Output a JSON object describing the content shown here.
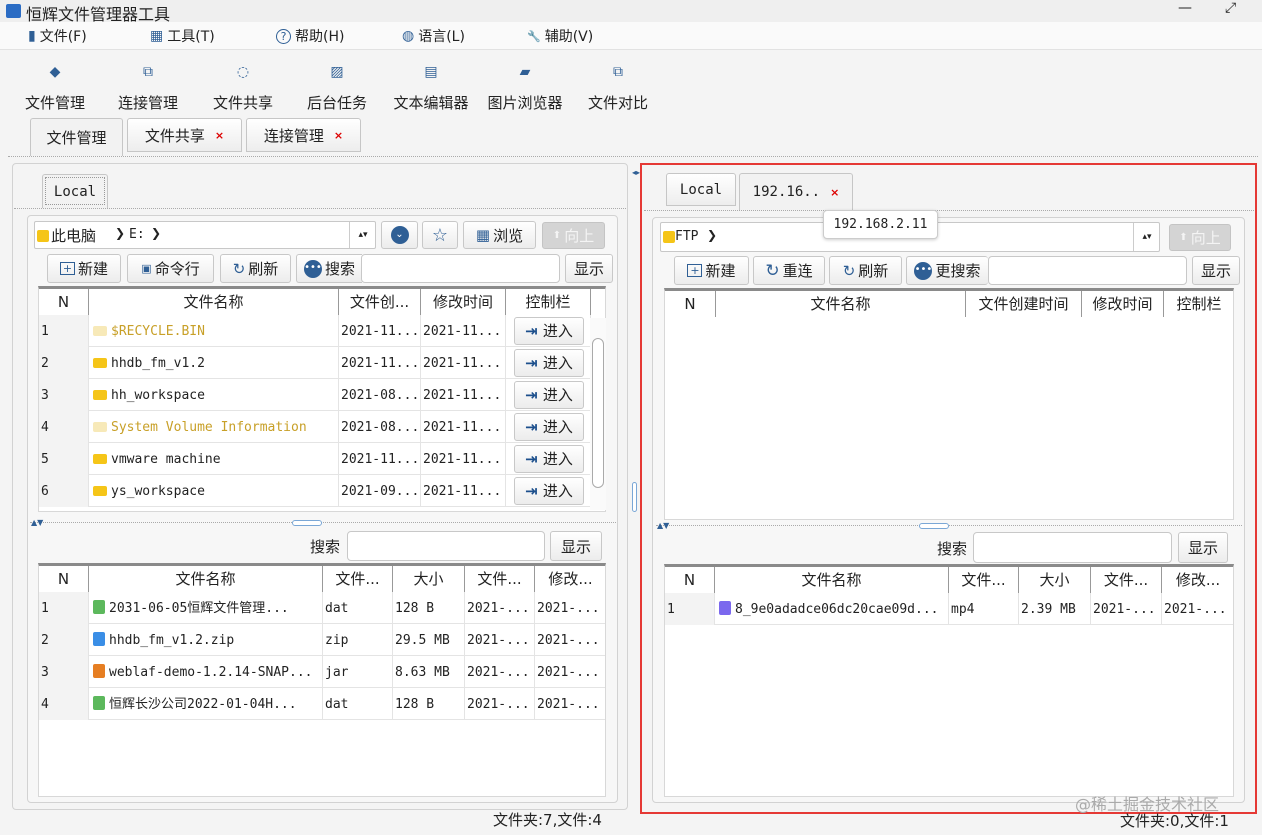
{
  "window": {
    "title": "恒辉文件管理器工具",
    "minimize": "—",
    "maximize": "⤢"
  },
  "menu": [
    {
      "label": "文件(F)",
      "icon": "file-icon",
      "glyph": "▮"
    },
    {
      "label": "工具(T)",
      "icon": "grid-icon",
      "glyph": "▦"
    },
    {
      "label": "帮助(H)",
      "icon": "help-icon",
      "glyph": "?"
    },
    {
      "label": "语言(L)",
      "icon": "globe-icon",
      "glyph": "◍"
    },
    {
      "label": "辅助(V)",
      "icon": "wrench-icon",
      "glyph": "🔧"
    }
  ],
  "toolbar": [
    {
      "label": "文件管理",
      "icon": "layers-icon",
      "glyph": "◆"
    },
    {
      "label": "连接管理",
      "icon": "code-window-icon",
      "glyph": "⧉"
    },
    {
      "label": "文件共享",
      "icon": "share-icon",
      "glyph": "◌"
    },
    {
      "label": "后台任务",
      "icon": "chart-icon",
      "glyph": "▨"
    },
    {
      "label": "文本编辑器",
      "icon": "text-editor-icon",
      "glyph": "▤"
    },
    {
      "label": "图片浏览器",
      "icon": "image-icon",
      "glyph": "▰"
    },
    {
      "label": "文件对比",
      "icon": "compare-icon",
      "glyph": "⧉"
    }
  ],
  "doc_tabs": [
    {
      "label": "文件管理",
      "closable": false
    },
    {
      "label": "文件共享",
      "closable": true
    },
    {
      "label": "连接管理",
      "closable": true
    }
  ],
  "close_glyph": "×",
  "left": {
    "tab": "Local",
    "path": {
      "folder": "此电脑",
      "sep": "❯",
      "drive": "E:",
      "sep2": "❯"
    },
    "buttons": {
      "browse": "浏览",
      "up": "向上",
      "new": "新建",
      "cmd": "命令行",
      "refresh": "刷新",
      "search": "搜索",
      "show": "显示"
    },
    "columns": [
      "N",
      "文件名称",
      "文件创...",
      "修改时间",
      "控制栏"
    ],
    "enter_label": "进入",
    "rows": [
      {
        "n": "1",
        "name": "$RECYCLE.BIN",
        "created": "2021-11...",
        "modified": "2021-11...",
        "system": true
      },
      {
        "n": "2",
        "name": "hhdb_fm_v1.2",
        "created": "2021-11...",
        "modified": "2021-11...",
        "system": false
      },
      {
        "n": "3",
        "name": "hh_workspace",
        "created": "2021-08...",
        "modified": "2021-11...",
        "system": false
      },
      {
        "n": "4",
        "name": "System Volume Information",
        "created": "2021-08...",
        "modified": "2021-11...",
        "system": true
      },
      {
        "n": "5",
        "name": "vmware machine",
        "created": "2021-11...",
        "modified": "2021-11...",
        "system": false
      },
      {
        "n": "6",
        "name": "ys_workspace",
        "created": "2021-09...",
        "modified": "2021-11...",
        "system": false
      }
    ],
    "search_label": "搜索",
    "show_label": "显示",
    "file_columns": [
      "N",
      "文件名称",
      "文件...",
      "大小",
      "文件...",
      "修改..."
    ],
    "files": [
      {
        "n": "1",
        "name": "2031-06-05恒辉文件管理...",
        "type": "dat",
        "size": "128 B",
        "created": "2021-...",
        "modified": "2021-...",
        "icon": "dat-file-icon",
        "color": "#5cb85c"
      },
      {
        "n": "2",
        "name": "hhdb_fm_v1.2.zip",
        "type": "zip",
        "size": "29.5 MB",
        "created": "2021-...",
        "modified": "2021-...",
        "icon": "zip-file-icon",
        "color": "#3a8ee6"
      },
      {
        "n": "3",
        "name": "weblaf-demo-1.2.14-SNAP...",
        "type": "jar",
        "size": "8.63 MB",
        "created": "2021-...",
        "modified": "2021-...",
        "icon": "java-file-icon",
        "color": "#e67e22"
      },
      {
        "n": "4",
        "name": "恒辉长沙公司2022-01-04H...",
        "type": "dat",
        "size": "128 B",
        "created": "2021-...",
        "modified": "2021-...",
        "icon": "dat-file-icon",
        "color": "#5cb85c"
      }
    ],
    "status": "文件夹:7,文件:4"
  },
  "right": {
    "tabs": [
      {
        "label": "Local"
      },
      {
        "label": "192.16.."
      }
    ],
    "tooltip": "192.168.2.11",
    "path": {
      "folder": "FTP",
      "sep": "❯"
    },
    "buttons": {
      "up": "向上",
      "new": "新建",
      "reconnect": "重连",
      "refresh": "刷新",
      "search": "更搜索",
      "show": "显示"
    },
    "columns": [
      "N",
      "文件名称",
      "文件创建时间",
      "修改时间",
      "控制栏"
    ],
    "search_label": "搜索",
    "show_label": "显示",
    "file_columns": [
      "N",
      "文件名称",
      "文件...",
      "大小",
      "文件...",
      "修改..."
    ],
    "files": [
      {
        "n": "1",
        "name": "8_9e0adadce06dc20cae09d...",
        "type": "mp4",
        "size": "2.39 MB",
        "created": "2021-...",
        "modified": "2021-...",
        "icon": "video-file-icon",
        "color": "#7b68ee"
      }
    ],
    "status": "文件夹:0,文件:1"
  },
  "watermark": "@稀土掘金技术社区",
  "colors": {
    "highlight_border": "#e53935",
    "system_folder_text": "#c8a028",
    "icon_blue": "#2f5f95"
  }
}
